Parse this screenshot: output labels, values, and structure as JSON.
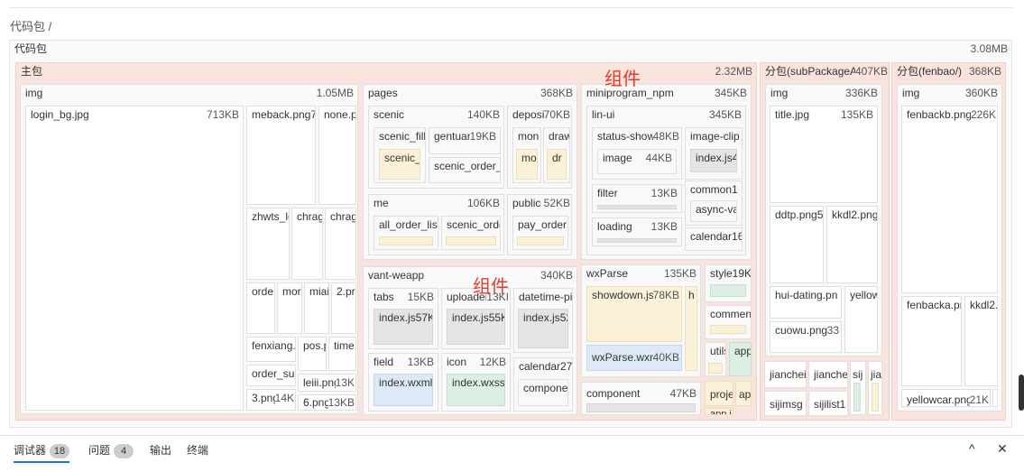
{
  "breadcrumb": "代码包 /",
  "root": {
    "label": "代码包",
    "size": "3.08MB"
  },
  "main": {
    "label": "主包",
    "size": "2.32MB"
  },
  "sub_a": {
    "label": "分包(subPackageA/)",
    "size": "407KB"
  },
  "sub_b": {
    "label": "分包(fenbao/)",
    "size": "368KB"
  },
  "annotation_label": "组件",
  "main_img": {
    "label": "img",
    "size": "1.05MB"
  },
  "login_bg": {
    "label": "login_bg.jpg",
    "size": "713KB"
  },
  "meback": "meback.png7",
  "none": "none.p",
  "zhwts": "zhwts_lc",
  "chrag1": "chrag",
  "chrag2": "chrag",
  "orde": "orde",
  "mor": "mor",
  "mia": "miai",
  "two_p": "2.pr",
  "fenxiang": "fenxiang.",
  "pos": "pos.p",
  "time": "time.",
  "order_su": "order_suc",
  "leiii": {
    "label": "leiii.png",
    "size": "13K"
  },
  "three_png": {
    "label": "3.png",
    "size": "14K"
  },
  "six_png": {
    "label": "6.png",
    "size": "13KB"
  },
  "pages": {
    "label": "pages",
    "size": "368KB"
  },
  "scenic": {
    "label": "scenic",
    "size": "140KB"
  },
  "scenic_fill": "scenic_fill",
  "gentuan": {
    "label": "gentuan",
    "size": "19KB"
  },
  "scenic_f": "scenic_f",
  "scenic_order": "scenic_order_",
  "deposit": {
    "label": "deposit",
    "size": "70KB"
  },
  "mon": "mon",
  "draw": "draw",
  "mo": "mo",
  "dr": "dr",
  "me": {
    "label": "me",
    "size": "106KB"
  },
  "all_order": "all_order_list",
  "scenic_orde": "scenic_orde",
  "public": {
    "label": "public",
    "size": "52KB"
  },
  "pay_order": "pay_order",
  "mini_npm": {
    "label": "miniprogram_npm",
    "size": "345KB"
  },
  "lin_ui": {
    "label": "lin-ui",
    "size": "345KB"
  },
  "status_show": {
    "label": "status-show",
    "size": "48KB"
  },
  "image_item": {
    "label": "image",
    "size": "44KB"
  },
  "image_clip": "image-clip",
  "index_js_clip": "index.js4",
  "filter": {
    "label": "filter",
    "size": "13KB"
  },
  "common1": "common1",
  "async_v": "async-va",
  "loading": {
    "label": "loading",
    "size": "13KB"
  },
  "calendar16": "calendar16",
  "vant": {
    "label": "vant-weapp",
    "size": "340KB"
  },
  "tabs": {
    "label": "tabs",
    "size": "15KB"
  },
  "tabs_index": "index.js57K",
  "uploader": {
    "label": "uploader",
    "size": "13KI"
  },
  "uploader_index": "index.js55K",
  "datetime": "datetime-pi",
  "datetime_index": "index.js52",
  "field": {
    "label": "field",
    "size": "13KB"
  },
  "field_index": "index.wxml",
  "icon_pkg": {
    "label": "icon",
    "size": "12KB"
  },
  "icon_index": "index.wxss",
  "calendar27": "calendar27",
  "compone": "compone",
  "wxparse": {
    "label": "wxParse",
    "size": "135KB"
  },
  "showdown": {
    "label": "showdown.js",
    "size": "78KB"
  },
  "h_item": "h",
  "wxparse_wxml": {
    "label": "wxParse.wxml",
    "size": "40KB"
  },
  "style19": "style19K",
  "commen": "commen",
  "utils": "utils",
  "app_item": "app",
  "component": {
    "label": "component",
    "size": "47KB"
  },
  "proje": "proje",
  "ap": "ap",
  "app_i": "app.i",
  "suba_img": {
    "label": "img",
    "size": "336KB"
  },
  "title_jpg": {
    "label": "title.jpg",
    "size": "135KB"
  },
  "ddtp": "ddtp.png5",
  "kkdl2_a": "kkdl2.png",
  "hui_dating": "hui-dating.pn",
  "yellow_a": "yellow",
  "cuowu": {
    "label": "cuowu.png",
    "size": "33"
  },
  "jianche1": "jianchei",
  "jianche2": "jianche",
  "sij": "sij",
  "jia": "jia",
  "sijimsg": "sijimsg",
  "sijilist": "sijilist1",
  "subb_img": {
    "label": "img",
    "size": "360KB"
  },
  "fenbackb": {
    "label": "fenbackb.png",
    "size": "226K"
  },
  "fenbacka": "fenbacka.pr",
  "kkdl2_b": "kkdl2.",
  "yellowcar": {
    "label": "yellowcar.png",
    "size": "21K"
  },
  "panel": {
    "tab_debugger": "调试器",
    "debugger_count": "18",
    "tab_issues": "问题",
    "issues_count": "4",
    "tab_output": "输出",
    "tab_terminal": "终端",
    "collapse": "^",
    "close": "✕"
  },
  "colors": {
    "accent_red": "#e03b2e",
    "main_pink": "#f8e4dc",
    "cream": "#fbf1d8",
    "blue": "#dde9f7",
    "green": "#dcefe4"
  }
}
